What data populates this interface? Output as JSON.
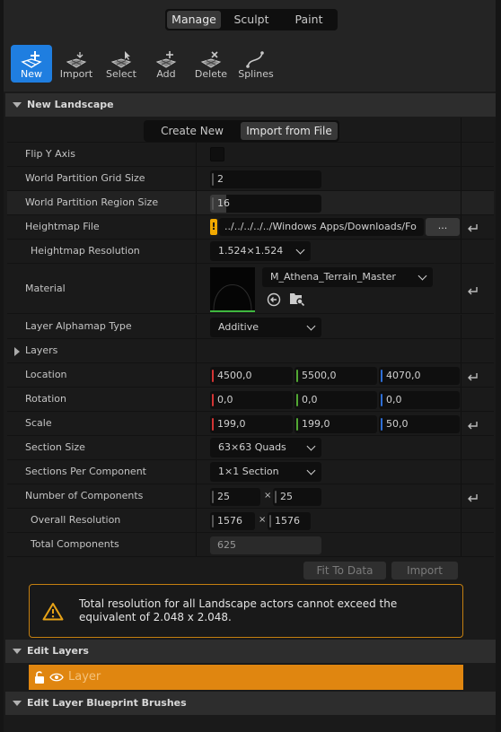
{
  "modes": [
    {
      "label": "Manage",
      "active": true
    },
    {
      "label": "Sculpt"
    },
    {
      "label": "Paint"
    }
  ],
  "tools": {
    "new": "New",
    "import": "Import",
    "select": "Select",
    "add": "Add",
    "delete": "Delete",
    "splines": "Splines"
  },
  "sections": {
    "new_landscape": "New Landscape",
    "edit_layers": "Edit Layers",
    "edit_bp_brushes": "Edit Layer Blueprint Brushes"
  },
  "source_tabs": {
    "create_new": "Create New",
    "import_from_file": "Import from File"
  },
  "labels": {
    "flip_y": "Flip Y Axis",
    "grid_size": "World Partition Grid Size",
    "region_size": "World Partition Region Size",
    "heightmap_file": "Heightmap File",
    "heightmap_res": "Heightmap Resolution",
    "material": "Material",
    "alphamap_type": "Layer Alphamap Type",
    "layers": "Layers",
    "location": "Location",
    "rotation": "Rotation",
    "scale": "Scale",
    "section_size": "Section Size",
    "sections_per_comp": "Sections Per Component",
    "num_components": "Number of Components",
    "overall_res": "Overall Resolution",
    "total_components": "Total Components"
  },
  "values": {
    "grid_size": "2",
    "region_size": "16",
    "heightmap_path": "../../../../../Windows Apps/Downloads/Fo",
    "browse": "...",
    "heightmap_res": "1.524×1.524",
    "material": "M_Athena_Terrain_Master",
    "alphamap_type": "Additive",
    "location": [
      "4500,0",
      "5500,0",
      "4070,0"
    ],
    "rotation": [
      "0,0",
      "0,0",
      "0,0"
    ],
    "scale": [
      "199,0",
      "199,0",
      "50,0"
    ],
    "section_size": "63×63 Quads",
    "sections_per_comp": "1×1 Section",
    "num_components": [
      "25",
      "25"
    ],
    "overall_res": [
      "1576",
      "1576"
    ],
    "times": "×",
    "total_components": "625"
  },
  "buttons": {
    "fit_to_data": "Fit To Data",
    "import": "Import"
  },
  "warning": "Total resolution for all Landscape actors cannot exceed the equivalent of 2.048 x 2.048.",
  "layer": {
    "name": "Layer"
  },
  "colors": {
    "accent": "#1f7ee0",
    "warning": "#e08610",
    "axis_x": "#d23434",
    "axis_y": "#52a733",
    "axis_z": "#2e6fd6"
  }
}
